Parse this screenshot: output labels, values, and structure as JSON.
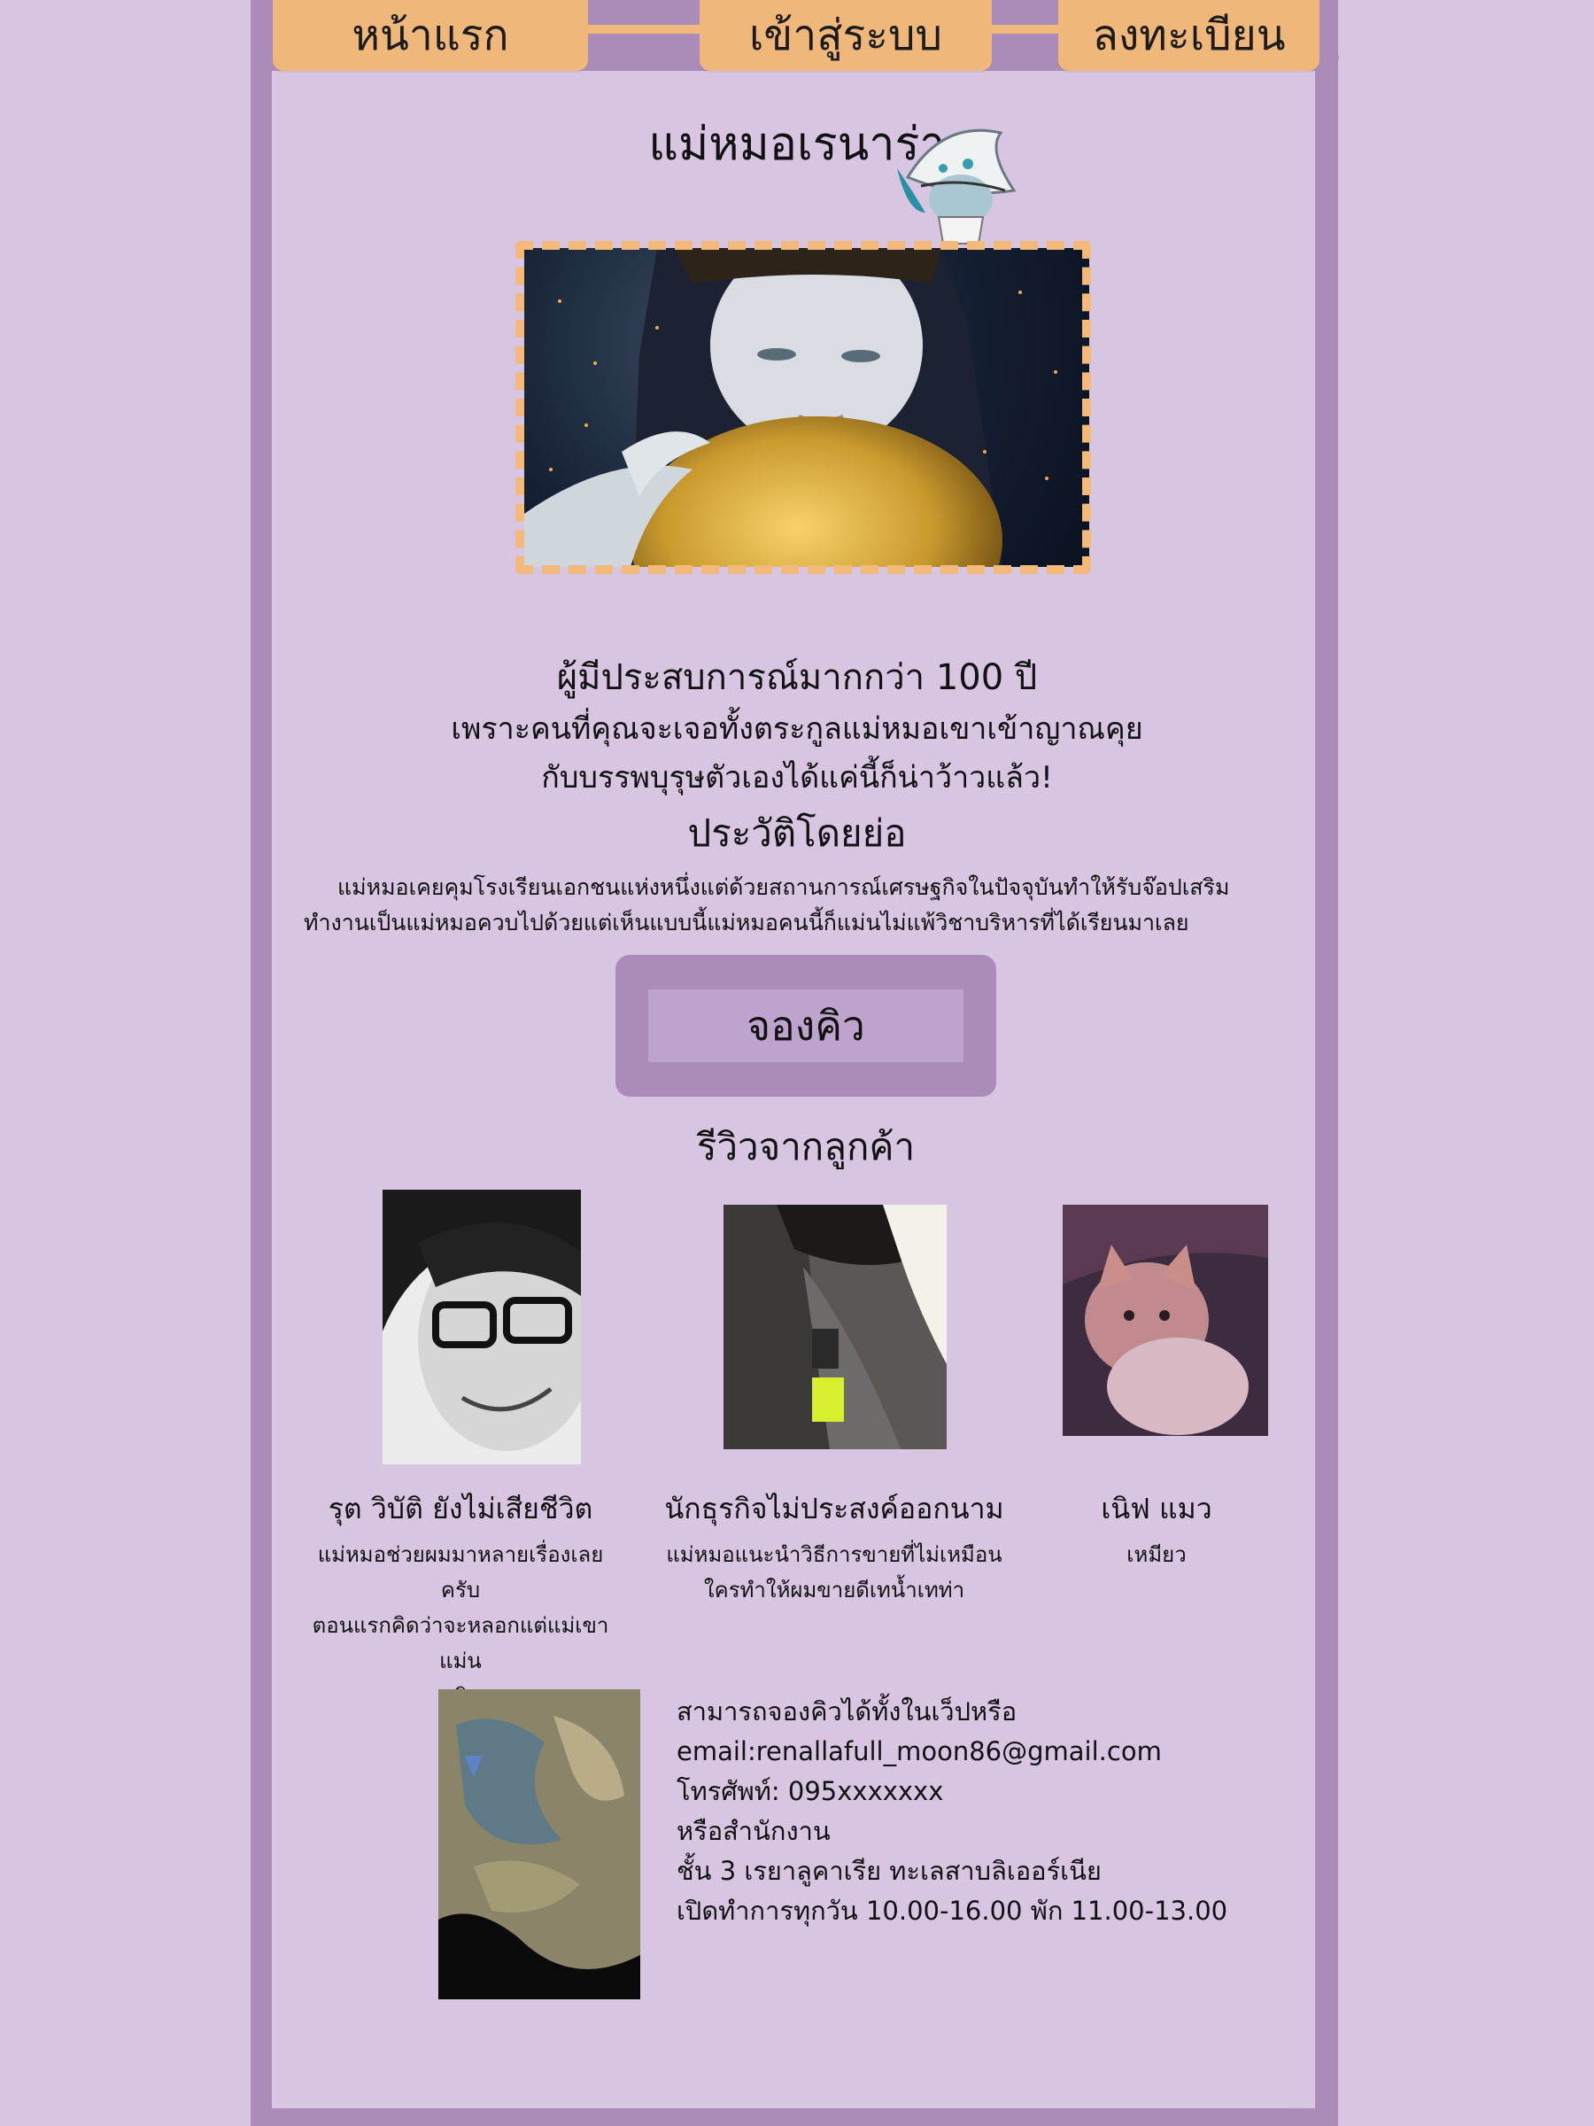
{
  "nav": {
    "home_label": "หน้าแรก",
    "login_label": "เข้าสู่ระบบ",
    "register_label": "ลงทะเบียน"
  },
  "page": {
    "title": "แม่หมอเรนาร่า",
    "experience": "ผู้มีประสบการณ์มากกว่า 100 ปี",
    "tagline_1": "เพราะคนที่คุณจะเจอทั้งตระกูลแม่หมอเขาเข้าญาณคุย",
    "tagline_2": "กับบรรพบุรุษตัวเองได้แค่นี้ก็น่าว้าวแล้ว!",
    "bio_heading": "ประวัติโดยย่อ",
    "bio_text": "แม่หมอเคยคุมโรงเรียนเอกชนแห่งหนึ่งแต่ด้วยสถานการณ์เศรษฐกิจในปัจจุบันทำให้รับจ๊อปเสริมทำงานเป็นแม่หมอควบไปด้วยแต่เห็นแบบนี้แม่หมอคนนี้ก็แม่นไม่แพ้วิชาบริหารที่ได้เรียนมาเลย",
    "book_button_label": "จองคิว",
    "reviews_heading": "รีวิวจากลูกค้า"
  },
  "reviews": [
    {
      "name": "รุต วิบัติ ยังไม่เสียชีวิต",
      "lines": [
        "แม่หมอช่วยผมมาหลายเรื่องเลยครับ",
        "ตอนแรกคิดว่าจะหลอกแต่แม่เขาแม่น",
        "จริง"
      ]
    },
    {
      "name": "นักธุรกิจไม่ประสงค์ออกนาม",
      "lines": [
        "แม่หมอแนะนำวิธีการขายที่ไม่เหมือน",
        "ใครทำให้ผมขายดีเทน้ำเทท่า"
      ]
    },
    {
      "name": "เนิฟ แมว",
      "lines": [
        "เหมียว"
      ]
    }
  ],
  "contact": {
    "lines": [
      "สามารถจองคิวได้ทั้งในเว็ปหรือ",
      "email:renallafull_moon86@gmail.com",
      "โทรศัพท์: 095xxxxxxx",
      "หรือสำนักงาน",
      "ชั้น 3 เรยาลูคาเรีย ทะเลสาบลิเออร์เนีย",
      "เปิดทำการทุกวัน 10.00-16.00 พัก 11.00-13.00"
    ]
  },
  "colors": {
    "background": "#d7c5e2",
    "frame": "#ab8cb8",
    "nav_button": "#f0b77a",
    "cta_inner": "#bea4cc"
  }
}
